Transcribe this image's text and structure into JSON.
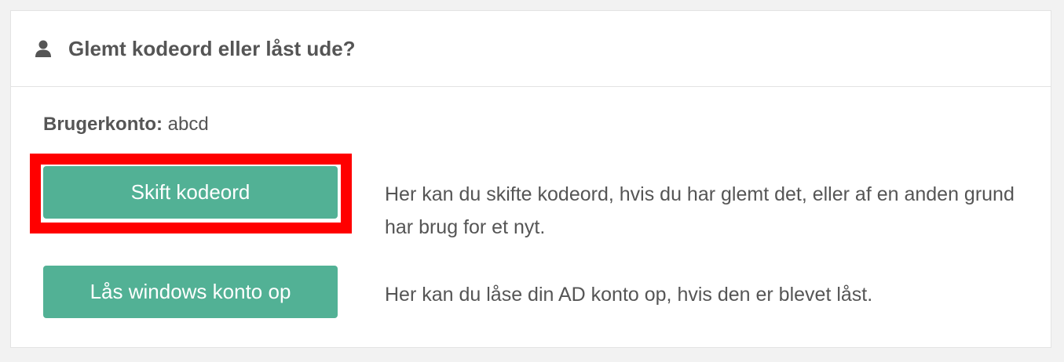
{
  "panel": {
    "title": "Glemt kodeord eller låst ude?",
    "icon": "user-icon"
  },
  "account": {
    "label": "Brugerkonto:",
    "value": "abcd"
  },
  "actions": [
    {
      "button_label": "Skift kodeord",
      "description": "Her kan du skifte kodeord, hvis du har glemt det, eller af en anden grund har brug for et nyt.",
      "highlighted": true
    },
    {
      "button_label": "Lås windows konto op",
      "description": "Her kan du låse din AD konto op, hvis den er blevet låst.",
      "highlighted": false
    }
  ],
  "colors": {
    "button": "#52b195",
    "highlight": "#ff0000",
    "text": "#555555"
  }
}
